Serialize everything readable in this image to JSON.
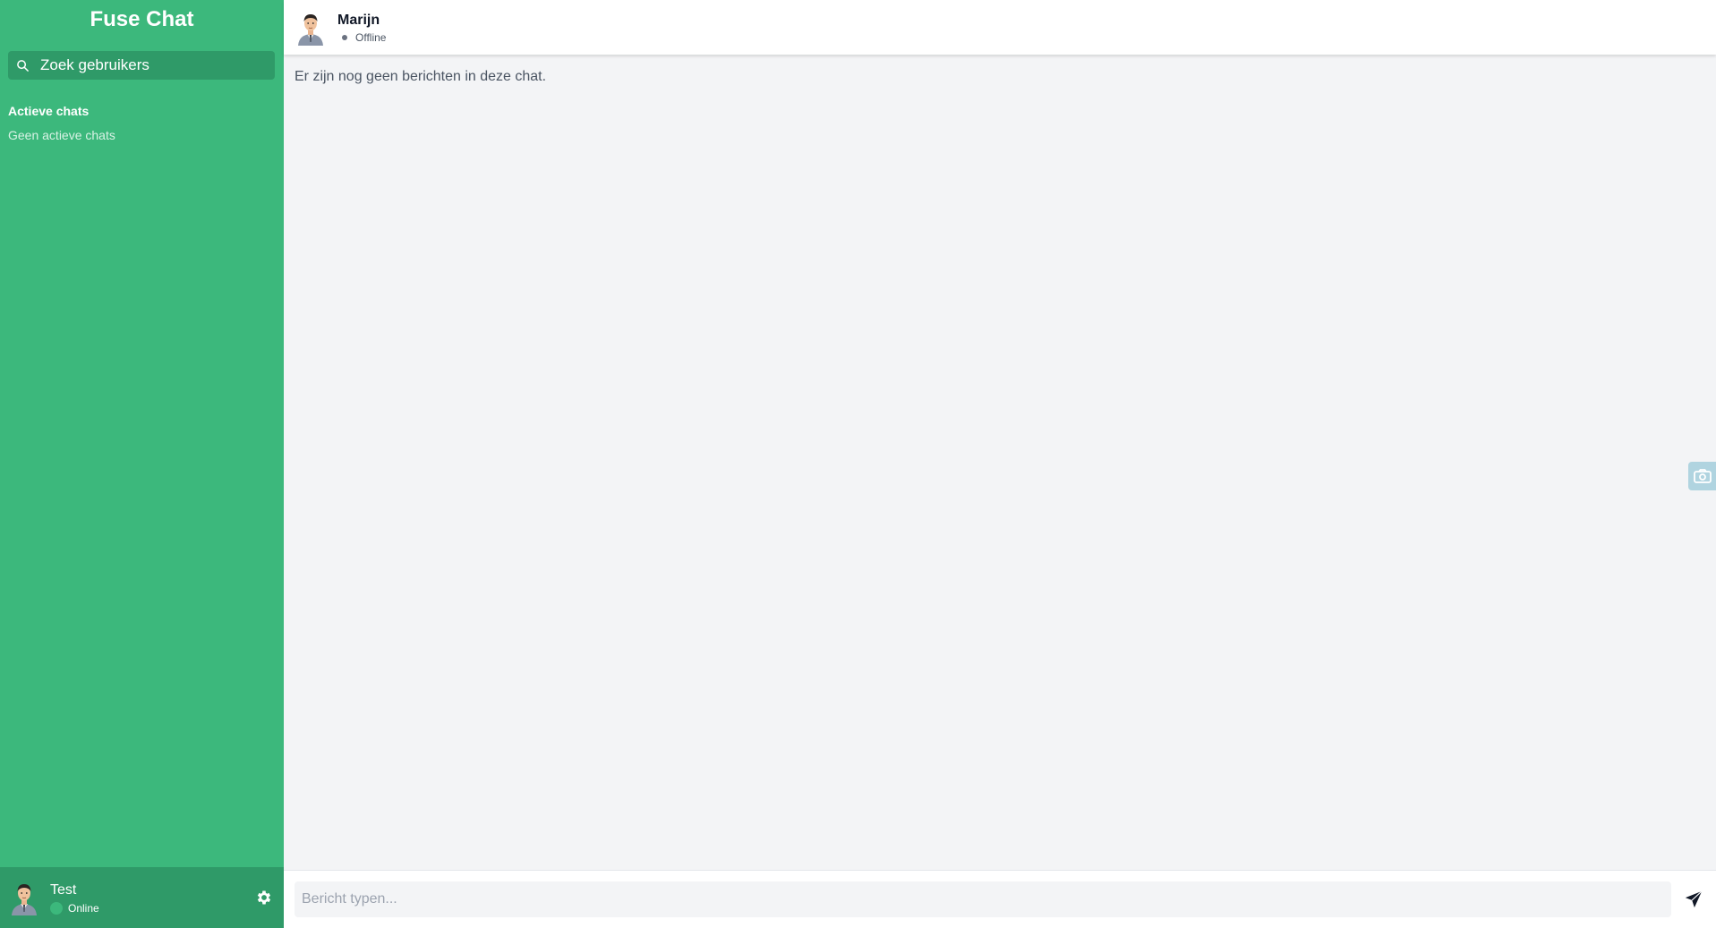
{
  "app": {
    "title": "Fuse Chat"
  },
  "search": {
    "placeholder": "Zoek gebruikers"
  },
  "sidebar": {
    "active_chats_title": "Actieve chats",
    "no_active_chats": "Geen actieve chats"
  },
  "current_user": {
    "name": "Test",
    "status": "Online"
  },
  "chat": {
    "contact_name": "Marijn",
    "contact_status": "Offline",
    "empty_message": "Er zijn nog geen berichten in deze chat."
  },
  "composer": {
    "placeholder": "Bericht typen..."
  },
  "colors": {
    "sidebar_bg": "#3cb87c",
    "sidebar_dark": "#2f9a68",
    "main_bg": "#f3f4f6"
  },
  "icons": {
    "search": "search-icon",
    "settings": "gear-icon",
    "send": "send-icon",
    "camera": "camera-icon"
  }
}
